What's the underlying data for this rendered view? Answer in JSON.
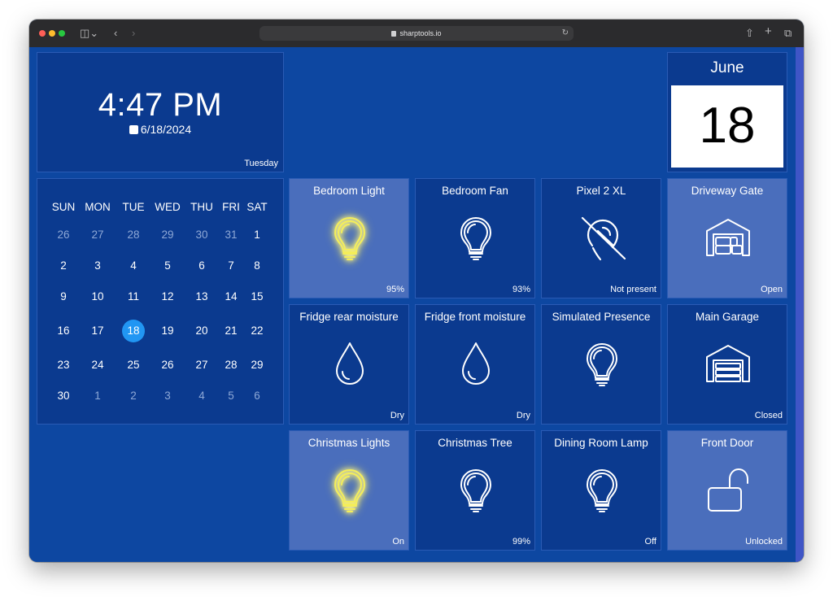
{
  "browser": {
    "url": "sharptools.io"
  },
  "clock": {
    "time": "4:47 PM",
    "date": "6/18/2024",
    "weekday": "Tuesday"
  },
  "month_card": {
    "month": "June",
    "day": "18"
  },
  "calendar": {
    "headers": [
      "SUN",
      "MON",
      "TUE",
      "WED",
      "THU",
      "FRI",
      "SAT"
    ],
    "weeks": [
      [
        {
          "d": "26",
          "dim": true
        },
        {
          "d": "27",
          "dim": true
        },
        {
          "d": "28",
          "dim": true
        },
        {
          "d": "29",
          "dim": true
        },
        {
          "d": "30",
          "dim": true
        },
        {
          "d": "31",
          "dim": true
        },
        {
          "d": "1"
        }
      ],
      [
        {
          "d": "2"
        },
        {
          "d": "3"
        },
        {
          "d": "4"
        },
        {
          "d": "5"
        },
        {
          "d": "6"
        },
        {
          "d": "7"
        },
        {
          "d": "8"
        }
      ],
      [
        {
          "d": "9"
        },
        {
          "d": "10"
        },
        {
          "d": "11"
        },
        {
          "d": "12"
        },
        {
          "d": "13"
        },
        {
          "d": "14"
        },
        {
          "d": "15"
        }
      ],
      [
        {
          "d": "16"
        },
        {
          "d": "17"
        },
        {
          "d": "18",
          "today": true
        },
        {
          "d": "19"
        },
        {
          "d": "20"
        },
        {
          "d": "21"
        },
        {
          "d": "22"
        }
      ],
      [
        {
          "d": "23"
        },
        {
          "d": "24"
        },
        {
          "d": "25"
        },
        {
          "d": "26"
        },
        {
          "d": "27"
        },
        {
          "d": "28"
        },
        {
          "d": "29"
        }
      ],
      [
        {
          "d": "30"
        },
        {
          "d": "1",
          "dim": true
        },
        {
          "d": "2",
          "dim": true
        },
        {
          "d": "3",
          "dim": true
        },
        {
          "d": "4",
          "dim": true
        },
        {
          "d": "5",
          "dim": true
        },
        {
          "d": "6",
          "dim": true
        }
      ]
    ]
  },
  "tiles": [
    {
      "title": "Bedroom Light",
      "status": "95%",
      "icon": "lightbulb-icon",
      "active": true,
      "glow": true
    },
    {
      "title": "Bedroom Fan",
      "status": "93%",
      "icon": "lightbulb-icon",
      "active": false,
      "glow": false
    },
    {
      "title": "Pixel 2 XL",
      "status": "Not present",
      "icon": "location-off-icon",
      "active": false,
      "glow": false
    },
    {
      "title": "Driveway Gate",
      "status": "Open",
      "icon": "garage-open-icon",
      "active": true,
      "glow": false
    },
    {
      "title": "Fridge rear moisture",
      "status": "Dry",
      "icon": "water-drop-icon",
      "active": false,
      "glow": false
    },
    {
      "title": "Fridge front moisture",
      "status": "Dry",
      "icon": "water-drop-icon",
      "active": false,
      "glow": false
    },
    {
      "title": "Simulated Presence",
      "status": "",
      "icon": "lightbulb-icon",
      "active": false,
      "glow": false
    },
    {
      "title": "Main Garage",
      "status": "Closed",
      "icon": "garage-closed-icon",
      "active": false,
      "glow": false
    },
    {
      "title": "Christmas Lights",
      "status": "On",
      "icon": "lightbulb-icon",
      "active": true,
      "glow": true
    },
    {
      "title": "Christmas Tree",
      "status": "99%",
      "icon": "lightbulb-icon",
      "active": false,
      "glow": false
    },
    {
      "title": "Dining Room Lamp",
      "status": "Off",
      "icon": "lightbulb-icon",
      "active": false,
      "glow": false
    },
    {
      "title": "Front Door",
      "status": "Unlocked",
      "icon": "lock-open-icon",
      "active": true,
      "glow": false
    }
  ]
}
